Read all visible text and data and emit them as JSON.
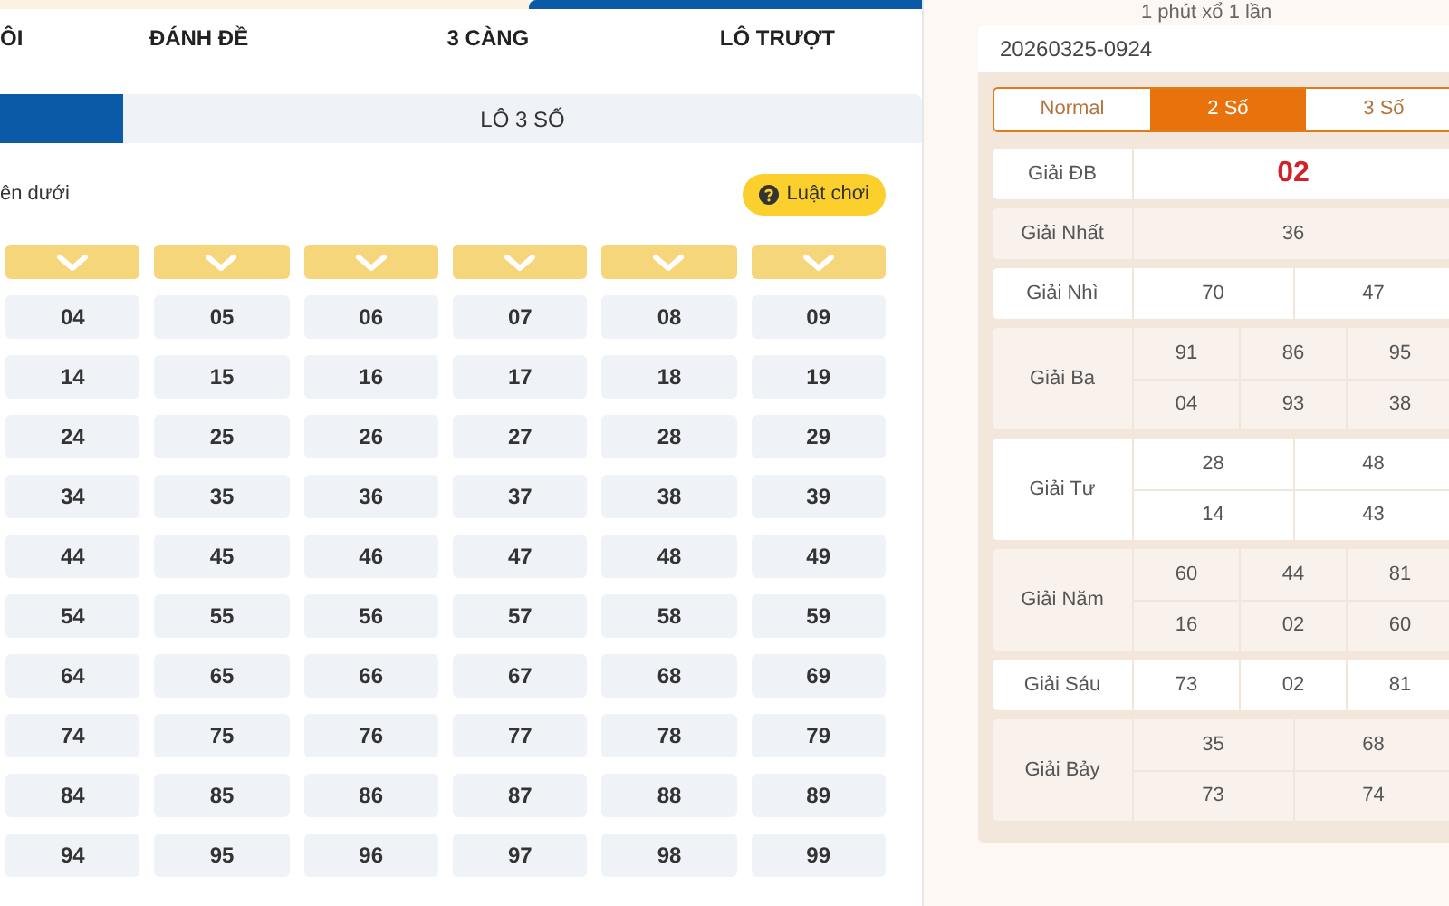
{
  "main_tabs": [
    {
      "label": "ÔI",
      "selected": false
    },
    {
      "label": "ĐÁNH ĐỀ",
      "selected": false
    },
    {
      "label": "3 CÀNG",
      "selected": false
    },
    {
      "label": "LÔ TRƯỢT",
      "selected": false
    }
  ],
  "sub_tabs": [
    {
      "selected": true
    },
    {
      "label": "LÔ 3 SỐ",
      "selected": false
    }
  ],
  "instruction": "ên dưới",
  "rules_button": "Luật chơi",
  "number_grid": [
    [
      "04",
      "05",
      "06",
      "07",
      "08",
      "09"
    ],
    [
      "14",
      "15",
      "16",
      "17",
      "18",
      "19"
    ],
    [
      "24",
      "25",
      "26",
      "27",
      "28",
      "29"
    ],
    [
      "34",
      "35",
      "36",
      "37",
      "38",
      "39"
    ],
    [
      "44",
      "45",
      "46",
      "47",
      "48",
      "49"
    ],
    [
      "54",
      "55",
      "56",
      "57",
      "58",
      "59"
    ],
    [
      "64",
      "65",
      "66",
      "67",
      "68",
      "69"
    ],
    [
      "74",
      "75",
      "76",
      "77",
      "78",
      "79"
    ],
    [
      "84",
      "85",
      "86",
      "87",
      "88",
      "89"
    ],
    [
      "94",
      "95",
      "96",
      "97",
      "98",
      "99"
    ]
  ],
  "results": {
    "caption": "1 phút xổ 1 lần",
    "draw_id": "20260325-0924",
    "modes": [
      {
        "label": "Normal",
        "selected": false
      },
      {
        "label": "2 Số",
        "selected": true
      },
      {
        "label": "3 Số",
        "selected": false
      }
    ],
    "prizes": [
      {
        "name": "Giải ĐB",
        "kind": "special",
        "rows": [
          [
            "02"
          ]
        ]
      },
      {
        "name": "Giải Nhất",
        "kind": "normal",
        "rows": [
          [
            "36"
          ]
        ]
      },
      {
        "name": "Giải Nhì",
        "kind": "normal",
        "rows": [
          [
            "70",
            "47"
          ]
        ]
      },
      {
        "name": "Giải Ba",
        "kind": "normal",
        "rows": [
          [
            "91",
            "86",
            "95"
          ],
          [
            "04",
            "93",
            "38"
          ]
        ]
      },
      {
        "name": "Giải Tư",
        "kind": "normal",
        "rows": [
          [
            "28",
            "48"
          ],
          [
            "14",
            "43"
          ]
        ]
      },
      {
        "name": "Giải Năm",
        "kind": "normal",
        "rows": [
          [
            "60",
            "44",
            "81"
          ],
          [
            "16",
            "02",
            "60"
          ]
        ]
      },
      {
        "name": "Giải Sáu",
        "kind": "normal",
        "rows": [
          [
            "73",
            "02",
            "81"
          ]
        ]
      },
      {
        "name": "Giải Bảy",
        "kind": "normal",
        "rows": [
          [
            "35",
            "68"
          ],
          [
            "73",
            "74"
          ]
        ]
      }
    ]
  }
}
